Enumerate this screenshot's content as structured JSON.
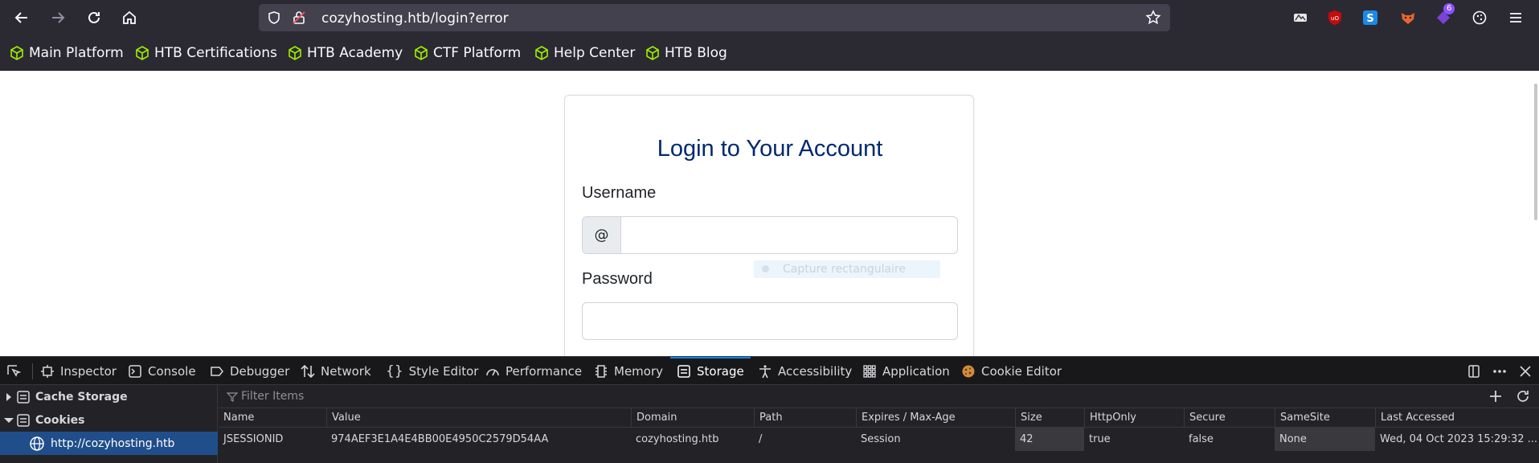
{
  "browser": {
    "url": "cozyhosting.htb/login?error",
    "extension_badge": "6",
    "bookmarks": [
      {
        "label": "Main Platform"
      },
      {
        "label": "HTB Certifications"
      },
      {
        "label": "HTB Academy"
      },
      {
        "label": "CTF Platform"
      },
      {
        "label": "Help Center"
      },
      {
        "label": "HTB Blog"
      }
    ]
  },
  "page": {
    "title": "Login to Your Account",
    "username_label": "Username",
    "username_addon": "@",
    "username_value": "",
    "password_label": "Password",
    "password_value": "",
    "overlay_text": "Capture rectangulaire"
  },
  "devtools": {
    "tabs": [
      {
        "label": "Inspector",
        "icon": "inspector-icon"
      },
      {
        "label": "Console",
        "icon": "console-icon"
      },
      {
        "label": "Debugger",
        "icon": "debugger-icon"
      },
      {
        "label": "Network",
        "icon": "network-icon"
      },
      {
        "label": "Style Editor",
        "icon": "style-editor-icon"
      },
      {
        "label": "Performance",
        "icon": "performance-icon"
      },
      {
        "label": "Memory",
        "icon": "memory-icon"
      },
      {
        "label": "Storage",
        "icon": "storage-icon",
        "active": true
      },
      {
        "label": "Accessibility",
        "icon": "accessibility-icon"
      },
      {
        "label": "Application",
        "icon": "application-icon"
      },
      {
        "label": "Cookie Editor",
        "icon": "cookie-icon"
      }
    ],
    "sidebar": {
      "cache_storage": "Cache Storage",
      "cookies": "Cookies",
      "cookie_host": "http://cozyhosting.htb"
    },
    "filter_placeholder": "Filter Items",
    "columns": [
      "Name",
      "Value",
      "Domain",
      "Path",
      "Expires / Max-Age",
      "Size",
      "HttpOnly",
      "Secure",
      "SameSite",
      "Last Accessed"
    ],
    "rows": [
      {
        "name": "JSESSIONID",
        "value": "974AEF3E1A4E4BB00E4950C2579D54AA",
        "domain": "cozyhosting.htb",
        "path": "/",
        "expires": "Session",
        "size": "42",
        "httponly": "true",
        "secure": "false",
        "samesite": "None",
        "last_accessed": "Wed, 04 Oct 2023 15:29:32 ..."
      }
    ]
  },
  "colors": {
    "chrome_bg": "#2b2a33",
    "urlbar_bg": "#42414d",
    "htb_green": "#9fef00",
    "devtools_bg": "#232327",
    "selection_blue": "#204e8a",
    "accent_blue": "#0a84ff",
    "title_navy": "#012970"
  }
}
